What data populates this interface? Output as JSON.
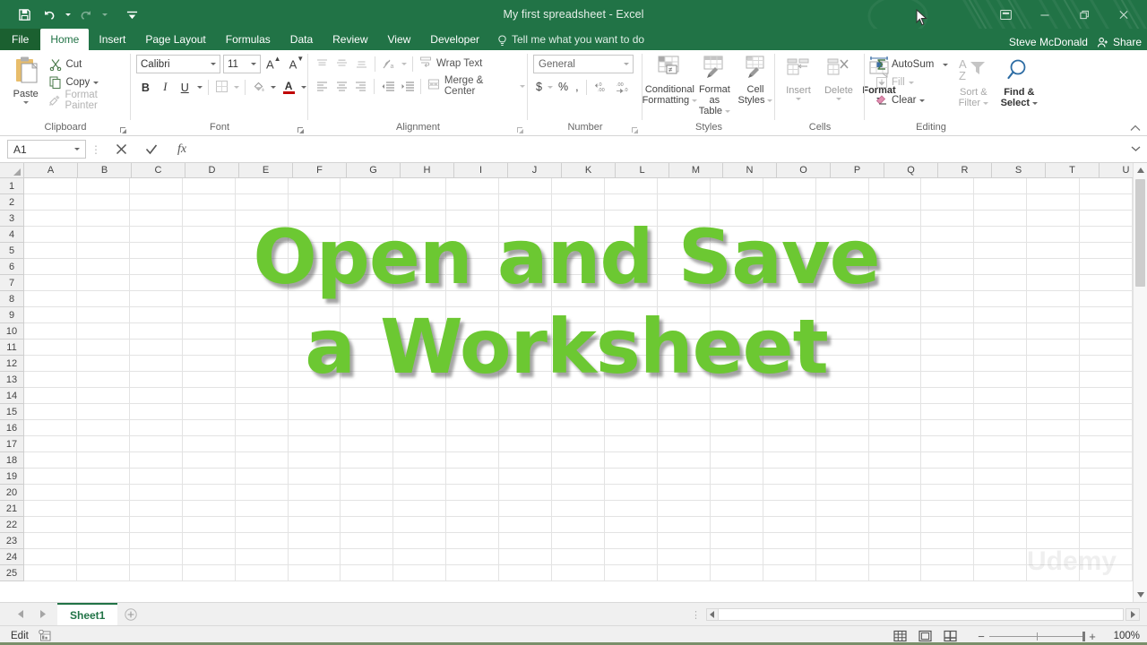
{
  "window": {
    "title": "My first spreadsheet - Excel",
    "user": "Steve McDonald",
    "share_label": "Share",
    "quick_access": [
      {
        "name": "save",
        "label": "Save"
      },
      {
        "name": "undo",
        "label": "Undo"
      },
      {
        "name": "redo",
        "label": "Redo"
      },
      {
        "name": "customize",
        "label": "Customize Quick Access Toolbar"
      }
    ],
    "window_buttons": [
      {
        "name": "ribbon-display-options",
        "label": "Ribbon Display Options"
      },
      {
        "name": "minimize",
        "label": "Minimize"
      },
      {
        "name": "restore",
        "label": "Restore Down"
      },
      {
        "name": "close",
        "label": "Close"
      }
    ]
  },
  "ribbon": {
    "tabs": [
      {
        "label": "File",
        "active": false
      },
      {
        "label": "Home",
        "active": true
      },
      {
        "label": "Insert",
        "active": false
      },
      {
        "label": "Page Layout",
        "active": false
      },
      {
        "label": "Formulas",
        "active": false
      },
      {
        "label": "Data",
        "active": false
      },
      {
        "label": "Review",
        "active": false
      },
      {
        "label": "View",
        "active": false
      },
      {
        "label": "Developer",
        "active": false
      }
    ],
    "tell_me": "Tell me what you want to do",
    "groups": {
      "clipboard": {
        "label": "Clipboard",
        "paste": "Paste",
        "cut": "Cut",
        "copy": "Copy",
        "format_painter": "Format Painter"
      },
      "font": {
        "label": "Font",
        "font_name": "Calibri",
        "font_size": "11",
        "grow_font": "A",
        "shrink_font": "A",
        "bold": "B",
        "italic": "I",
        "underline": "U",
        "borders": "Borders",
        "fill_color": "Fill Color",
        "font_color": "A"
      },
      "alignment": {
        "label": "Alignment",
        "wrap_text": "Wrap Text",
        "merge_center": "Merge & Center"
      },
      "number": {
        "label": "Number",
        "format": "General",
        "currency": "$",
        "percent": "%",
        "comma": ",",
        "increase_decimal": ".00",
        "decrease_decimal": ".00"
      },
      "styles": {
        "label": "Styles",
        "conditional_formatting": "Conditional\nFormatting",
        "conditional_formatting_l1": "Conditional",
        "conditional_formatting_l2": "Formatting",
        "format_as_table_l1": "Format as",
        "format_as_table_l2": "Table",
        "cell_styles_l1": "Cell",
        "cell_styles_l2": "Styles"
      },
      "cells": {
        "label": "Cells",
        "insert": "Insert",
        "delete": "Delete",
        "format": "Format"
      },
      "editing": {
        "label": "Editing",
        "autosum": "AutoSum",
        "fill": "Fill",
        "clear": "Clear",
        "sort_filter_l1": "Sort &",
        "sort_filter_l2": "Filter",
        "find_select_l1": "Find &",
        "find_select_l2": "Select"
      }
    }
  },
  "formula_bar": {
    "name_box": "A1",
    "cancel": "✕",
    "enter": "✓",
    "insert_function": "fx",
    "value": "",
    "placeholder": ""
  },
  "grid": {
    "columns": [
      "A",
      "B",
      "C",
      "D",
      "E",
      "F",
      "G",
      "H",
      "I",
      "J",
      "K",
      "L",
      "M",
      "N",
      "O",
      "P",
      "Q",
      "R",
      "S",
      "T",
      "U"
    ],
    "rows": [
      "1",
      "2",
      "3",
      "4",
      "5",
      "6",
      "7",
      "8",
      "9",
      "10",
      "11",
      "12",
      "13",
      "14",
      "15",
      "16",
      "17",
      "18",
      "19",
      "20",
      "21",
      "22",
      "23",
      "24",
      "25"
    ],
    "selected_cell": "A1",
    "overlay_title_lines": [
      "Open and Save",
      "a Worksheet"
    ],
    "overlay_title_color": "#6cc832",
    "watermark": "Udemy"
  },
  "sheet_tabs": {
    "tabs": [
      {
        "label": "Sheet1",
        "active": true
      }
    ],
    "add_sheet": "+",
    "nav_first": "◀",
    "nav_last": "▶"
  },
  "status_bar": {
    "mode": "Edit",
    "macro_record": "Record Macro",
    "views": [
      {
        "name": "normal-view",
        "label": "Normal"
      },
      {
        "name": "page-layout-view",
        "label": "Page Layout"
      },
      {
        "name": "page-break-view",
        "label": "Page Break Preview"
      }
    ],
    "zoom_out": "−",
    "zoom_in": "+",
    "zoom_level": "100%"
  },
  "colors": {
    "excel_green": "#217346",
    "file_tab_green": "#1b6030",
    "title_green": "#6cc832",
    "accent_red": "#c00000"
  }
}
